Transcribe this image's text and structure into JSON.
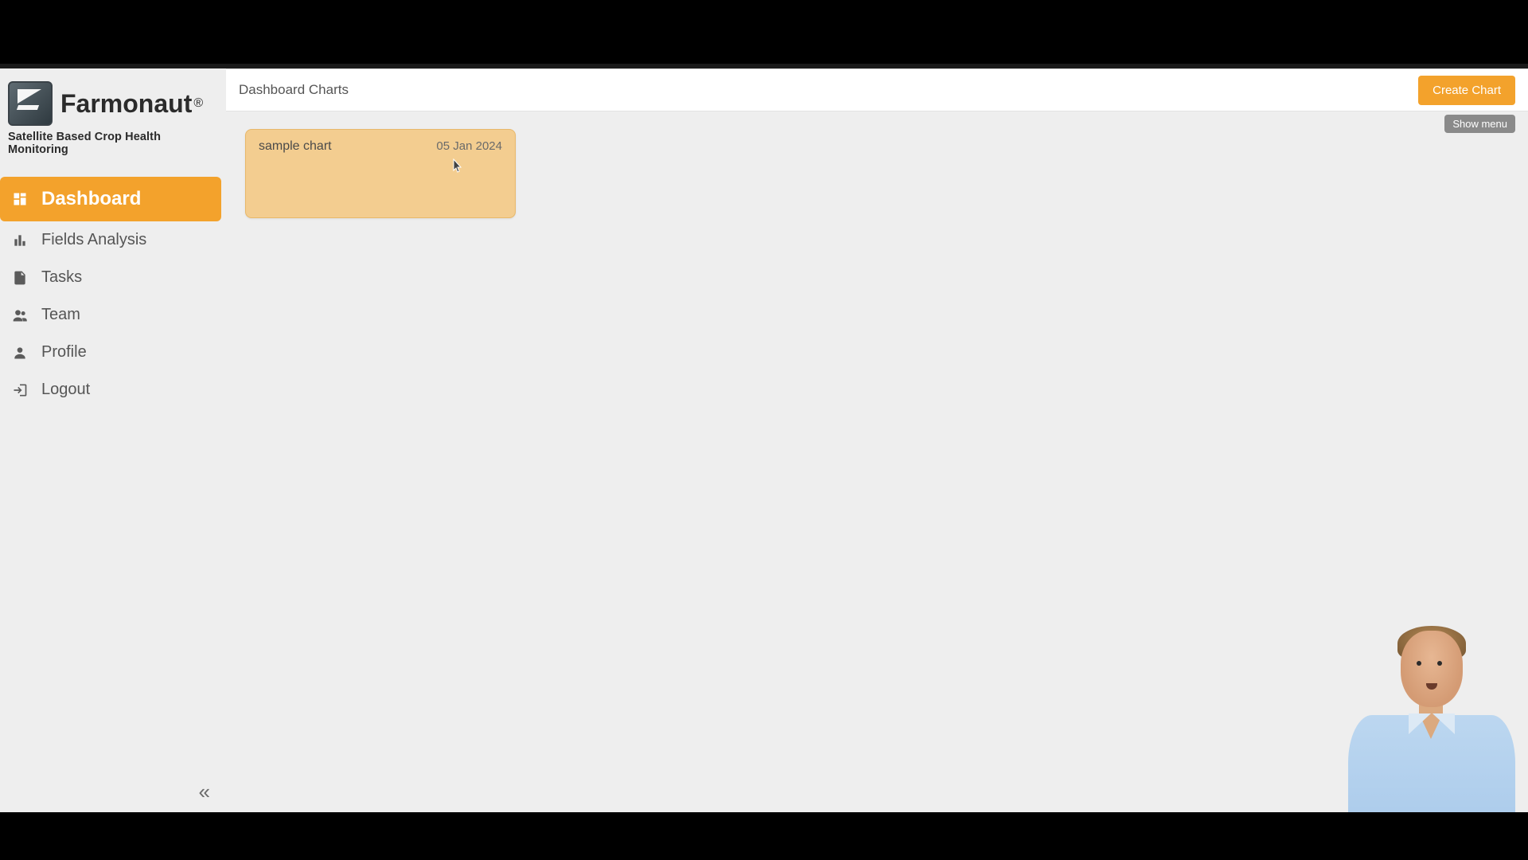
{
  "brand": {
    "name": "Farmonaut",
    "registered": "®",
    "tagline": "Satellite Based Crop Health Monitoring"
  },
  "sidebar": {
    "items": [
      {
        "label": "Dashboard",
        "icon": "dashboard-icon",
        "active": true
      },
      {
        "label": "Fields Analysis",
        "icon": "bars-icon",
        "active": false
      },
      {
        "label": "Tasks",
        "icon": "task-icon",
        "active": false
      },
      {
        "label": "Team",
        "icon": "people-icon",
        "active": false
      },
      {
        "label": "Profile",
        "icon": "person-icon",
        "active": false
      },
      {
        "label": "Logout",
        "icon": "logout-icon",
        "active": false
      }
    ]
  },
  "header": {
    "title": "Dashboard Charts",
    "create_chart_label": "Create Chart",
    "show_menu_label": "Show menu"
  },
  "charts": [
    {
      "title": "sample chart",
      "date": "05 Jan 2024"
    }
  ],
  "colors": {
    "accent": "#f3a22c",
    "card": "#f3cd90",
    "bg": "#eeeeee"
  }
}
